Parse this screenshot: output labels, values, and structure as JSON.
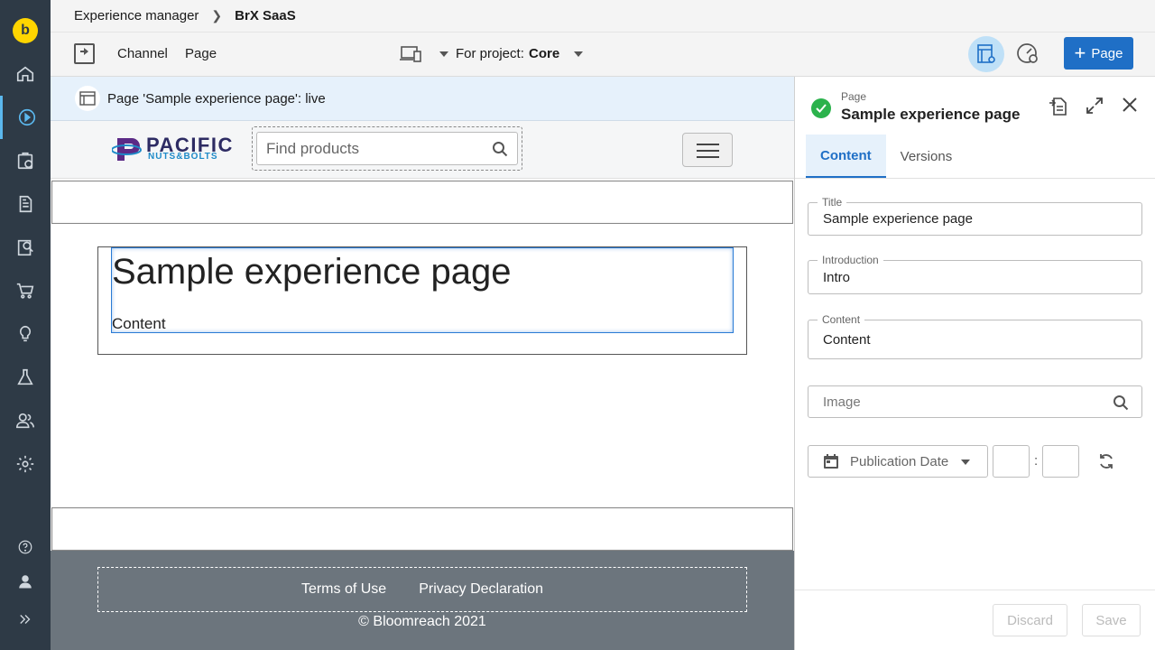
{
  "rail": {
    "logo_letter": "b",
    "items": [
      "home-icon",
      "experience-manager-icon",
      "projects-icon",
      "content-icon",
      "seo-icon",
      "commerce-icon",
      "insights-icon",
      "experiments-icon",
      "audiences-icon",
      "settings-icon"
    ],
    "bottom": [
      "help-icon",
      "user-icon",
      "expand-icon"
    ],
    "accent": "#5bb8ee"
  },
  "breadcrumb": {
    "app": "Experience manager",
    "current": "BrX SaaS"
  },
  "toolbar": {
    "channel_label": "Channel",
    "page_label": "Page",
    "project_label": "For project:",
    "project_value": "Core",
    "add_page_label": "Page"
  },
  "canvas": {
    "banner_text": "Page 'Sample experience page': live",
    "logo_line1": "PACIFIC",
    "logo_line2": "NUTS&BOLTS",
    "search_placeholder": "Find products",
    "heading": "Sample experience page",
    "content": "Content",
    "footer_links": [
      "Terms of Use",
      "Privacy Declaration"
    ],
    "copyright": "© Bloomreach 2021"
  },
  "panel": {
    "type_label": "Page",
    "title": "Sample experience page",
    "tabs": [
      "Content",
      "Versions"
    ],
    "fields": {
      "title_label": "Title",
      "title_value": "Sample experience page",
      "intro_label": "Introduction",
      "intro_value": "Intro",
      "content_label": "Content",
      "content_value": "Content",
      "image_placeholder": "Image",
      "pub_date_label": "Publication Date",
      "time_sep": ":"
    },
    "discard_label": "Discard",
    "save_label": "Save",
    "status_color": "#2bb24c",
    "brand_color": "#1f6fc6"
  }
}
